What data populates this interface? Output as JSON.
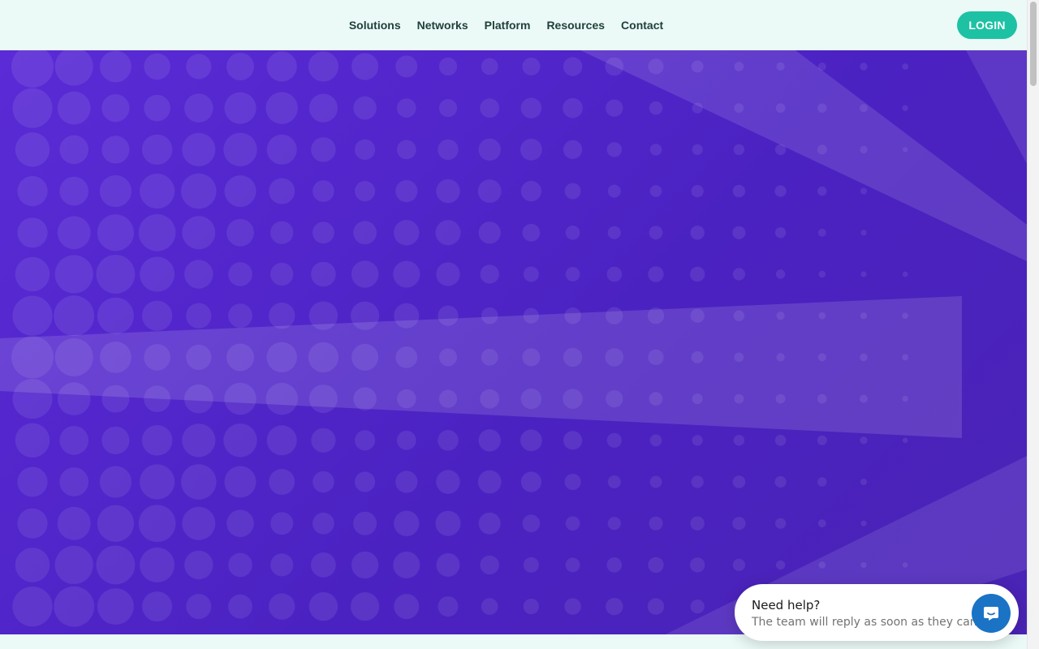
{
  "header": {
    "nav": [
      {
        "label": "Solutions"
      },
      {
        "label": "Networks"
      },
      {
        "label": "Platform"
      },
      {
        "label": "Resources"
      },
      {
        "label": "Contact"
      }
    ],
    "login_label": "LOGIN"
  },
  "chat": {
    "title": "Need help?",
    "subtitle": "The team will reply as soon as they can"
  },
  "colors": {
    "header_bg": "#ebfaf7",
    "hero_bg": "#4b22c2",
    "accent": "#1cc2a3",
    "chat_launcher": "#1a73c4"
  },
  "icons": {
    "chat_launcher": "chat-bubble-icon"
  }
}
